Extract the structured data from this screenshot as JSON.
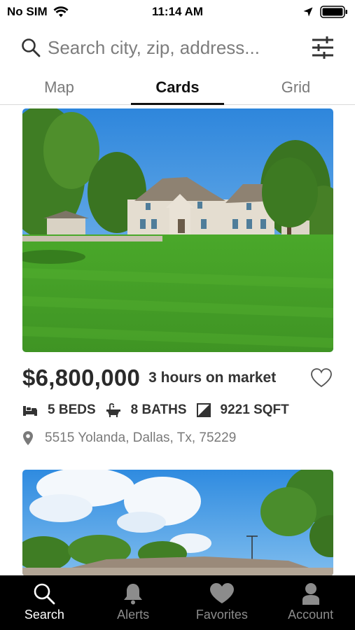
{
  "status_bar": {
    "carrier": "No SIM",
    "time": "11:14 AM",
    "icons": [
      "wifi-icon",
      "location-arrow-icon",
      "battery-icon"
    ]
  },
  "search": {
    "placeholder": "Search city, zip, address...",
    "icon": "search-icon",
    "filter_icon": "sliders-icon"
  },
  "tabs": [
    {
      "label": "Map",
      "active": false
    },
    {
      "label": "Cards",
      "active": true
    },
    {
      "label": "Grid",
      "active": false
    }
  ],
  "listings": [
    {
      "price": "$6,800,000",
      "market_time": "3 hours on market",
      "beds": "5 BEDS",
      "baths": "8 BATHS",
      "sqft": "9221 SQFT",
      "address": "5515 Yolanda, Dallas, Tx, 75229",
      "favorited": false
    },
    {
      "partial": true
    }
  ],
  "bottom_nav": [
    {
      "label": "Search",
      "icon": "search-icon",
      "active": true
    },
    {
      "label": "Alerts",
      "icon": "bell-icon",
      "active": false
    },
    {
      "label": "Favorites",
      "icon": "heart-icon",
      "active": false
    },
    {
      "label": "Account",
      "icon": "person-icon",
      "active": false
    }
  ],
  "colors": {
    "nav_background": "#000000",
    "nav_active": "#ffffff",
    "nav_inactive": "#8c8c8c",
    "price_text": "#2a2a2a",
    "muted_text": "#7a7a7a"
  }
}
